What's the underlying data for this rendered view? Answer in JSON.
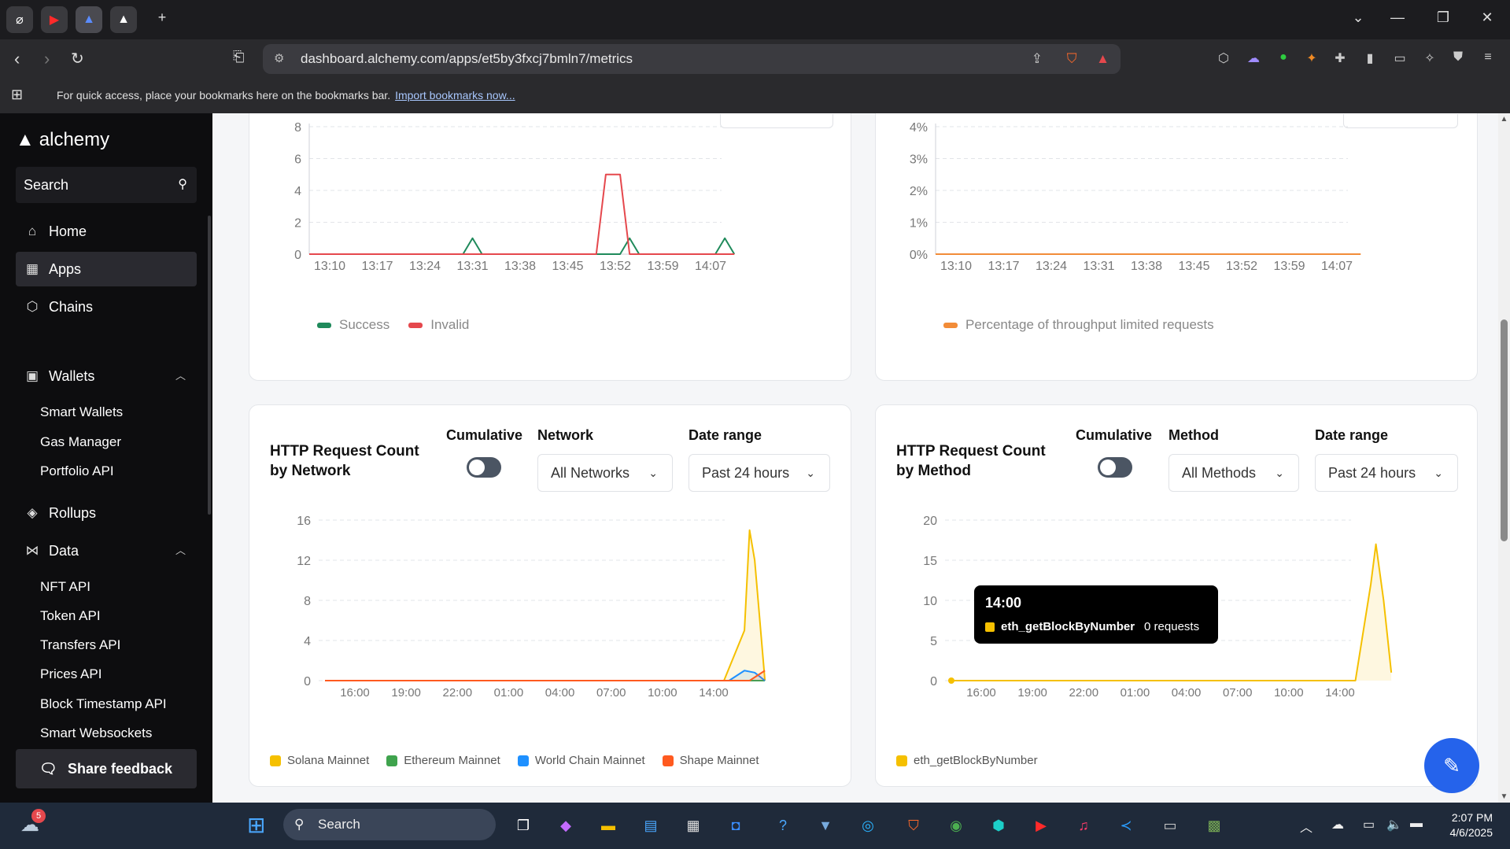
{
  "browser": {
    "url": "dashboard.alchemy.com/apps/et5by3fxcj7bmln7/metrics",
    "bookmarks_text": "For quick access, place your bookmarks here on the bookmarks bar.",
    "bookmarks_link": "Import bookmarks now...",
    "badge_count": "5"
  },
  "sidebar": {
    "brand": "alchemy",
    "search_placeholder": "Search",
    "items": [
      {
        "label": "Home",
        "icon": "home-icon"
      },
      {
        "label": "Apps",
        "icon": "grid-icon"
      },
      {
        "label": "Chains",
        "icon": "cube-icon"
      },
      {
        "label": "Wallets",
        "icon": "wallet-icon"
      },
      {
        "label": "Rollups",
        "icon": "layers-icon"
      },
      {
        "label": "Data",
        "icon": "bowtie-icon"
      }
    ],
    "wallets_sub": [
      "Smart Wallets",
      "Gas Manager",
      "Portfolio API"
    ],
    "data_sub": [
      "NFT API",
      "Token API",
      "Transfers API",
      "Prices API",
      "Block Timestamp API",
      "Smart Websockets"
    ],
    "share_feedback": "Share feedback"
  },
  "charts": {
    "top_left": {
      "legend": [
        "Success",
        "Invalid"
      ],
      "colors": {
        "success": "#1f8a5b",
        "invalid": "#e5484d"
      }
    },
    "top_right": {
      "legend": [
        "Percentage of throughput limited requests"
      ],
      "color": "#f28c38"
    },
    "network": {
      "title": "HTTP Request Count by Network",
      "cumulative_label": "Cumulative",
      "network_label": "Network",
      "network_value": "All Networks",
      "date_label": "Date range",
      "date_value": "Past 24 hours",
      "legend": [
        "Solana Mainnet",
        "Ethereum Mainnet",
        "World Chain Mainnet",
        "Shape Mainnet"
      ],
      "colors": [
        "#f5c000",
        "#3fa34d",
        "#1e90ff",
        "#ff5a1f"
      ]
    },
    "method": {
      "title": "HTTP Request Count by Method",
      "cumulative_label": "Cumulative",
      "method_label": "Method",
      "method_value": "All Methods",
      "date_label": "Date range",
      "date_value": "Past 24 hours",
      "legend": [
        "eth_getBlockByNumber"
      ],
      "color": "#f5c000",
      "tooltip": {
        "time": "14:00",
        "method": "eth_getBlockByNumber",
        "value": "0 requests"
      }
    }
  },
  "chart_data": [
    {
      "type": "line",
      "x": [
        "13:10",
        "13:17",
        "13:24",
        "13:31",
        "13:38",
        "13:45",
        "13:52",
        "13:59",
        "14:07"
      ],
      "ylim": [
        0,
        8
      ],
      "yticks": [
        "0",
        "2",
        "4",
        "6",
        "8"
      ],
      "series": [
        {
          "name": "Success",
          "points": [
            [
              0,
              0
            ],
            [
              2.8,
              0
            ],
            [
              3.0,
              1
            ],
            [
              3.2,
              0
            ],
            [
              6.1,
              0
            ],
            [
              6.3,
              1
            ],
            [
              6.5,
              0
            ],
            [
              8.1,
              0
            ],
            [
              8.3,
              1
            ],
            [
              8.5,
              0
            ]
          ]
        },
        {
          "name": "Invalid",
          "points": [
            [
              0,
              0
            ],
            [
              5.6,
              0
            ],
            [
              5.8,
              5
            ],
            [
              6.1,
              5
            ],
            [
              6.3,
              0
            ],
            [
              8.5,
              0
            ]
          ]
        }
      ]
    },
    {
      "type": "line",
      "x": [
        "13:10",
        "13:17",
        "13:24",
        "13:31",
        "13:38",
        "13:45",
        "13:52",
        "13:59",
        "14:07"
      ],
      "ylim": [
        0,
        4
      ],
      "yticks": [
        "0%",
        "1%",
        "2%",
        "3%",
        "4%"
      ],
      "series": [
        {
          "name": "Percentage of throughput limited requests",
          "points": [
            [
              0,
              0
            ],
            [
              8.5,
              0
            ]
          ]
        }
      ]
    },
    {
      "type": "area",
      "x": [
        "16:00",
        "19:00",
        "22:00",
        "01:00",
        "04:00",
        "07:00",
        "10:00",
        "14:00"
      ],
      "ylim": [
        0,
        16
      ],
      "yticks": [
        "0",
        "4",
        "8",
        "12",
        "16"
      ],
      "series": [
        {
          "name": "Solana Mainnet",
          "points": [
            [
              0,
              0
            ],
            [
              7.5,
              0
            ],
            [
              7.9,
              5
            ],
            [
              8.0,
              15
            ],
            [
              8.1,
              12
            ],
            [
              8.3,
              0
            ]
          ]
        },
        {
          "name": "Ethereum Mainnet",
          "points": [
            [
              0,
              0
            ],
            [
              8.3,
              0
            ]
          ]
        },
        {
          "name": "World Chain Mainnet",
          "points": [
            [
              0,
              0
            ],
            [
              7.6,
              0
            ],
            [
              7.9,
              1
            ],
            [
              8.1,
              0.8
            ],
            [
              8.3,
              0
            ]
          ]
        },
        {
          "name": "Shape Mainnet",
          "points": [
            [
              0,
              0
            ],
            [
              8.0,
              0
            ],
            [
              8.3,
              1
            ]
          ]
        }
      ]
    },
    {
      "type": "area",
      "x": [
        "16:00",
        "19:00",
        "22:00",
        "01:00",
        "04:00",
        "07:00",
        "10:00",
        "14:00"
      ],
      "ylim": [
        0,
        20
      ],
      "yticks": [
        "0",
        "5",
        "10",
        "15",
        "20"
      ],
      "series": [
        {
          "name": "eth_getBlockByNumber",
          "points": [
            [
              0,
              0
            ],
            [
              7.6,
              0
            ],
            [
              7.9,
              12
            ],
            [
              8.0,
              17
            ],
            [
              8.15,
              10
            ],
            [
              8.3,
              1
            ]
          ]
        }
      ]
    }
  ],
  "system": {
    "search": "Search",
    "time": "2:07 PM",
    "date": "4/6/2025",
    "notification_count": "5"
  }
}
